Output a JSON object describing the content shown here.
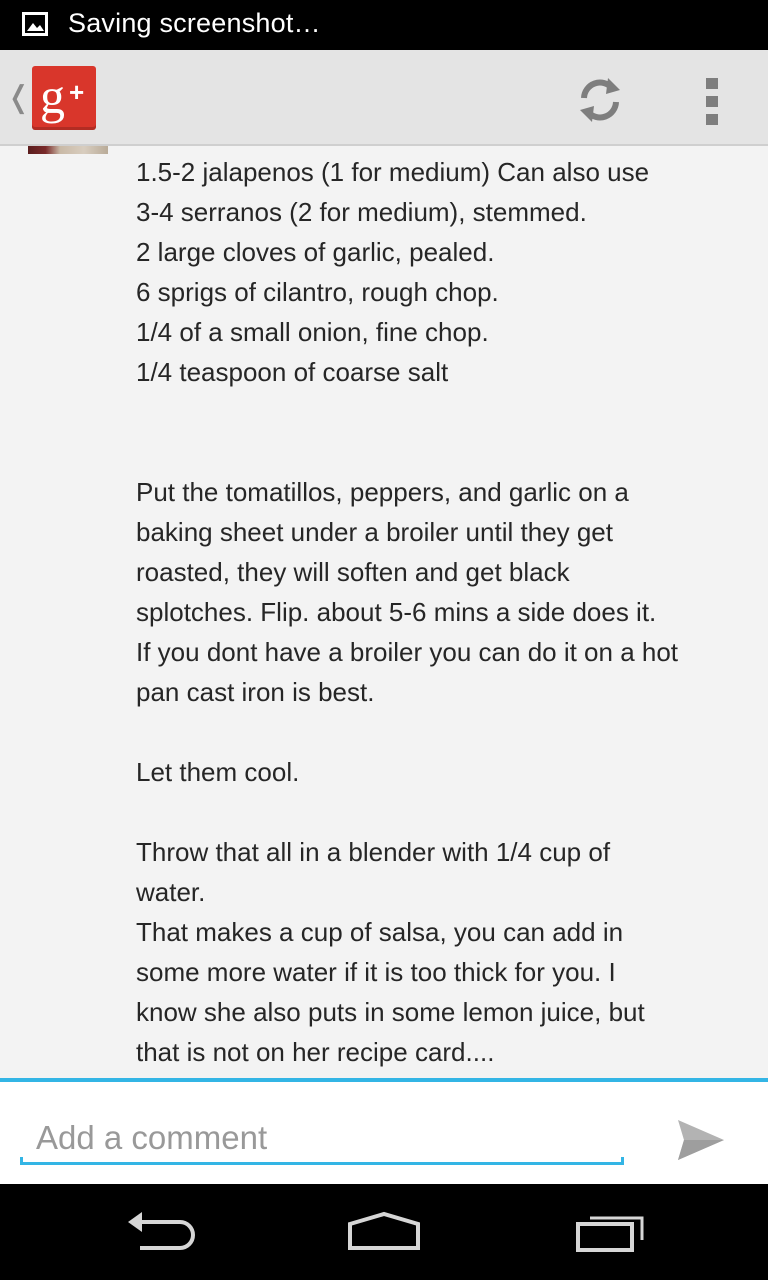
{
  "status_bar": {
    "notification_icon": "image-icon",
    "text": "Saving screenshot…"
  },
  "action_bar": {
    "up_caret": "❬",
    "logo": {
      "letter": "g",
      "plus": "+",
      "color": "#d9362b"
    },
    "refresh_icon": "refresh-icon",
    "overflow_icon": "overflow-menu-icon"
  },
  "comment": {
    "lines": [
      "1.5-2 jalapenos (1 for medium)  Can also use",
      "3-4 serranos (2 for medium), stemmed.",
      "2 large cloves of garlic, pealed.",
      "6 sprigs of cilantro, rough chop.",
      "1/4 of a small onion, fine chop.",
      "1/4 teaspoon of coarse salt",
      "",
      "",
      "Put the tomatillos, peppers, and garlic on a",
      "baking sheet under a broiler until they get",
      "roasted, they will soften and get black",
      "splotches.  Flip.  about 5-6 mins a side does it.",
      "If you dont have a broiler you can do it on a hot",
      "pan cast iron is best.",
      "",
      "Let them cool.",
      "",
      "Throw that all in a blender with 1/4 cup of",
      "water.",
      "That makes a cup of salsa, you can add in",
      "some more water if it is too thick for you.  I",
      "know she also puts in some lemon juice, but",
      "that is not on her recipe card...."
    ]
  },
  "composer": {
    "placeholder": "Add a comment",
    "value": "",
    "send_icon": "send-icon",
    "accent_color": "#33b5e5"
  },
  "nav_bar": {
    "back_icon": "back-icon",
    "home_icon": "home-icon",
    "recents_icon": "recent-apps-icon"
  }
}
